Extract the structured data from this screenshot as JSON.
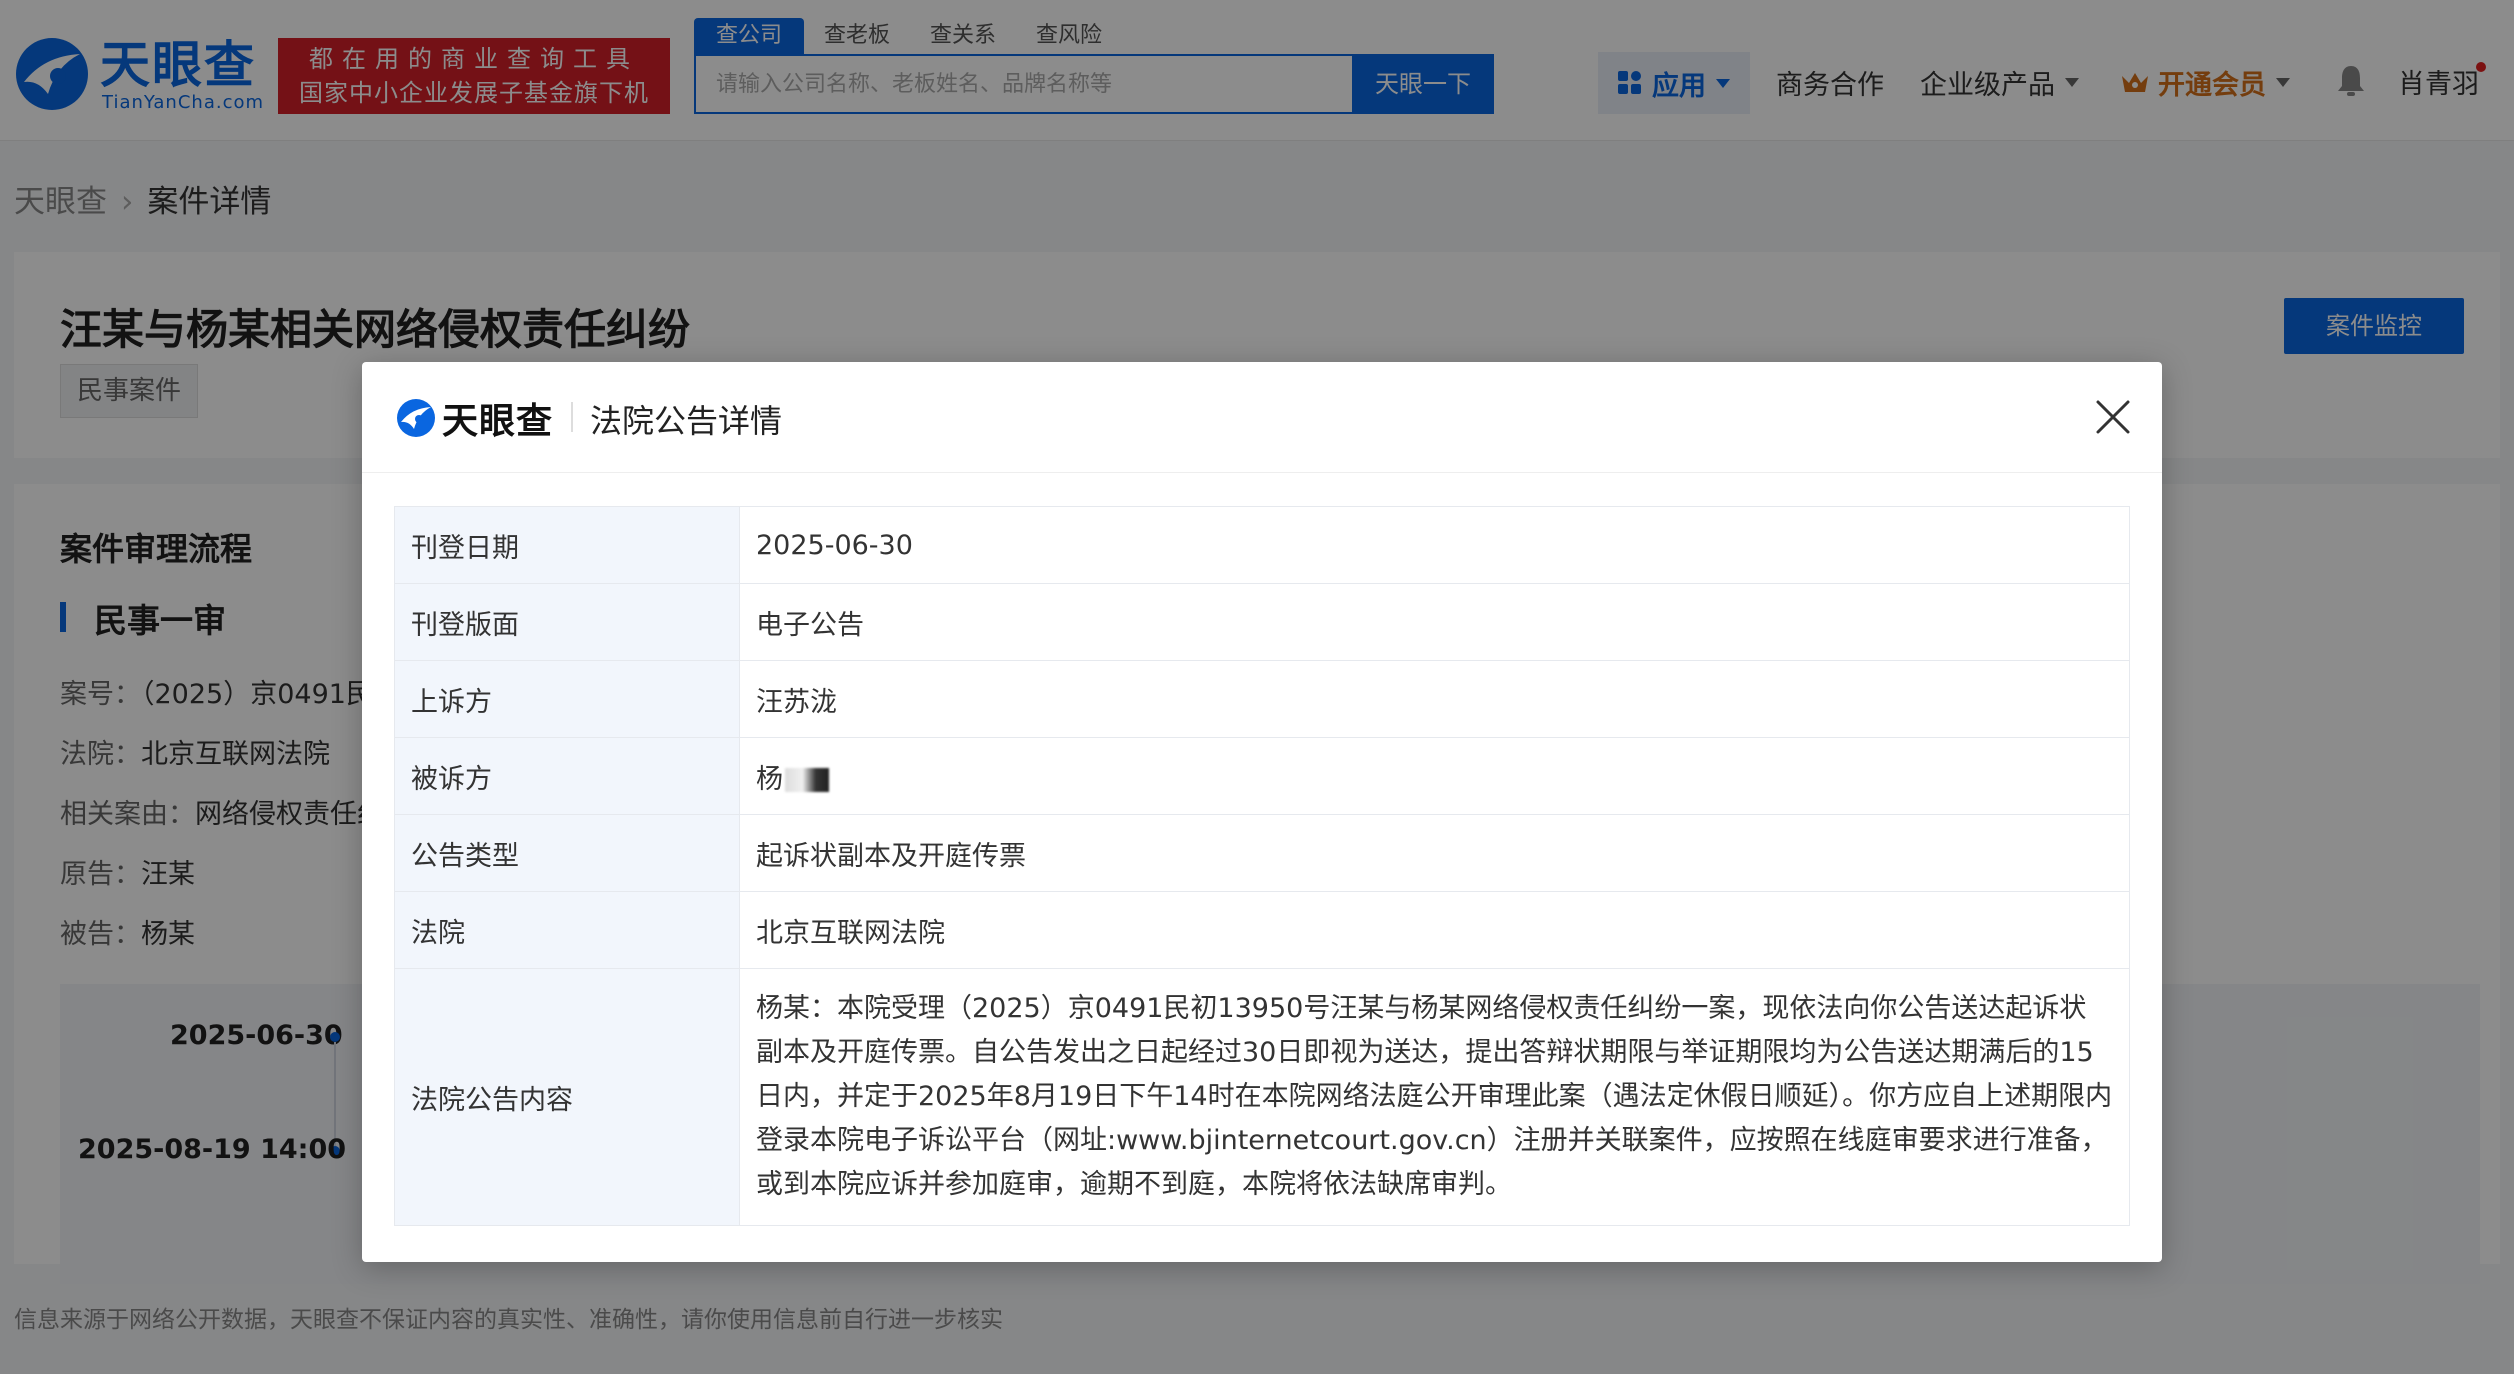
{
  "header": {
    "logo_text": "天眼查",
    "logo_domain": "TianYanCha.com",
    "banner_line1": "都在用的商业查询工具",
    "banner_line2": "国家中小企业发展子基金旗下机构",
    "search_tabs": [
      "查公司",
      "查老板",
      "查关系",
      "查风险"
    ],
    "search_placeholder": "请输入公司名称、老板姓名、品牌名称等",
    "search_button": "天眼一下",
    "nav": {
      "apps": "应用",
      "business": "商务合作",
      "enterprise": "企业级产品",
      "vip": "开通会员",
      "username": "肖青羽"
    }
  },
  "breadcrumb": {
    "home": "天眼查",
    "current": "案件详情"
  },
  "case": {
    "title": "汪某与杨某相关网络侵权责任纠纷",
    "tag": "民事案件",
    "monitor_button": "案件监控",
    "process_title": "案件审理流程",
    "stage_title": "民事一审",
    "case_no_label": "案号：",
    "case_no_value": "（2025）京0491民",
    "court_label": "法院：",
    "court_value": "北京互联网法院",
    "cause_label": "相关案由：",
    "cause_value": "网络侵权责任纠",
    "plaintiff_label": "原告：",
    "plaintiff_value": "汪某",
    "defendant_label": "被告：",
    "defendant_value": "杨某",
    "timeline": [
      "2025-06-30",
      "2025-08-19 14:00"
    ]
  },
  "footer_note": "信息来源于网络公开数据，天眼查不保证内容的真实性、准确性，请你使用信息前自行进一步核实",
  "modal": {
    "logo_text": "天眼查",
    "title": "法院公告详情",
    "rows": [
      {
        "label": "刊登日期",
        "value": "2025-06-30"
      },
      {
        "label": "刊登版面",
        "value": "电子公告"
      },
      {
        "label": "上诉方",
        "value": "汪苏泷"
      },
      {
        "label": "被诉方",
        "value": "杨"
      },
      {
        "label": "公告类型",
        "value": "起诉状副本及开庭传票"
      },
      {
        "label": "法院",
        "value": "北京互联网法院"
      },
      {
        "label": "法院公告内容",
        "value": "杨某：本院受理（2025）京0491民初13950号汪某与杨某网络侵权责任纠纷一案，现依法向你公告送达起诉状副本及开庭传票。自公告发出之日起经过30日即视为送达，提出答辩状期限与举证期限均为公告送达期满后的15日内，并定于2025年8月19日下午14时在本院网络法庭公开审理此案（遇法定休假日顺延）。你方应自上述期限内登录本院电子诉讼平台（网址:www.bjinternetcourt.gov.cn）注册并关联案件，应按照在线庭审要求进行准备，或到本院应诉并参加庭审，逾期不到庭，本院将依法缺席审判。"
      }
    ]
  },
  "colors": {
    "brand": "#0a66e0",
    "banner": "#d41f29",
    "vip": "#d4701a"
  }
}
